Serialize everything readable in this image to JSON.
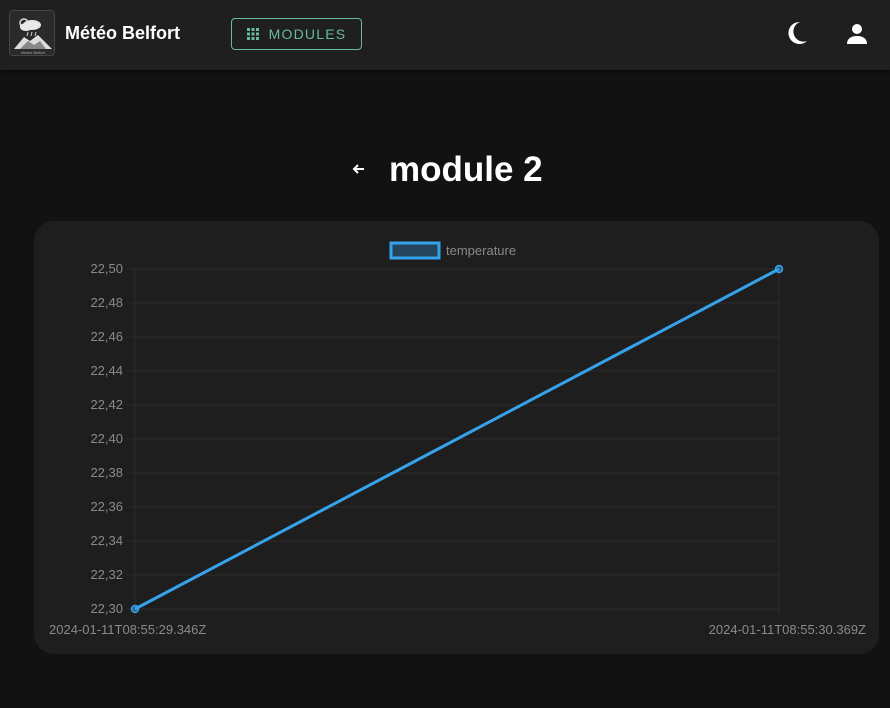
{
  "header": {
    "brand": "Météo Belfort",
    "logo_caption": "Météo Belfort",
    "modules_label": "MODULES",
    "accent_color": "#66bb9a",
    "icons": [
      "grid-icon",
      "moon-icon",
      "user-icon"
    ]
  },
  "page": {
    "title": "module 2",
    "back_icon": "arrow-left-icon"
  },
  "chart_data": {
    "type": "line",
    "x": [
      "2024-01-11T08:55:29.346Z",
      "2024-01-11T08:55:30.369Z"
    ],
    "series": [
      {
        "name": "temperature",
        "values": [
          22.3,
          22.5
        ],
        "color": "#36a2eb"
      }
    ],
    "ylim": [
      22.3,
      22.5
    ],
    "yticks": [
      "22,50",
      "22,48",
      "22,46",
      "22,44",
      "22,42",
      "22,40",
      "22,38",
      "22,36",
      "22,34",
      "22,32",
      "22,30"
    ],
    "legend_position": "top",
    "grid": true
  }
}
